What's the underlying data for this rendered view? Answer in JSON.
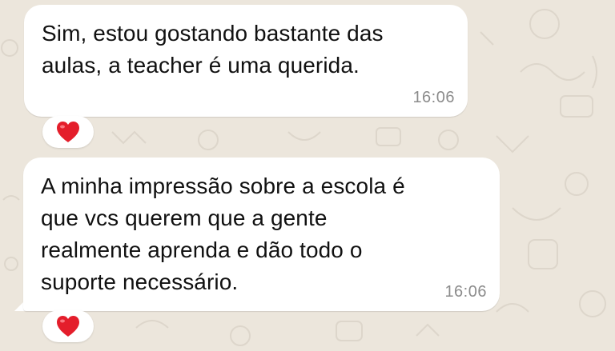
{
  "theme": {
    "wallpaper_color": "#ece6dc",
    "bubble_color": "#ffffff",
    "time_color": "#8b8b8b",
    "reaction_color": "#e41e2b"
  },
  "messages": [
    {
      "text": "Sim, estou gostando bastante das\naulas, a teacher é uma querida.",
      "time": "16:06",
      "reaction_icon": "heart-icon"
    },
    {
      "text": "A minha impressão sobre a escola é\nque vcs querem que a gente\nrealmente aprenda e dão todo o\nsuporte necessário.",
      "time": "16:06",
      "reaction_icon": "heart-icon"
    }
  ]
}
